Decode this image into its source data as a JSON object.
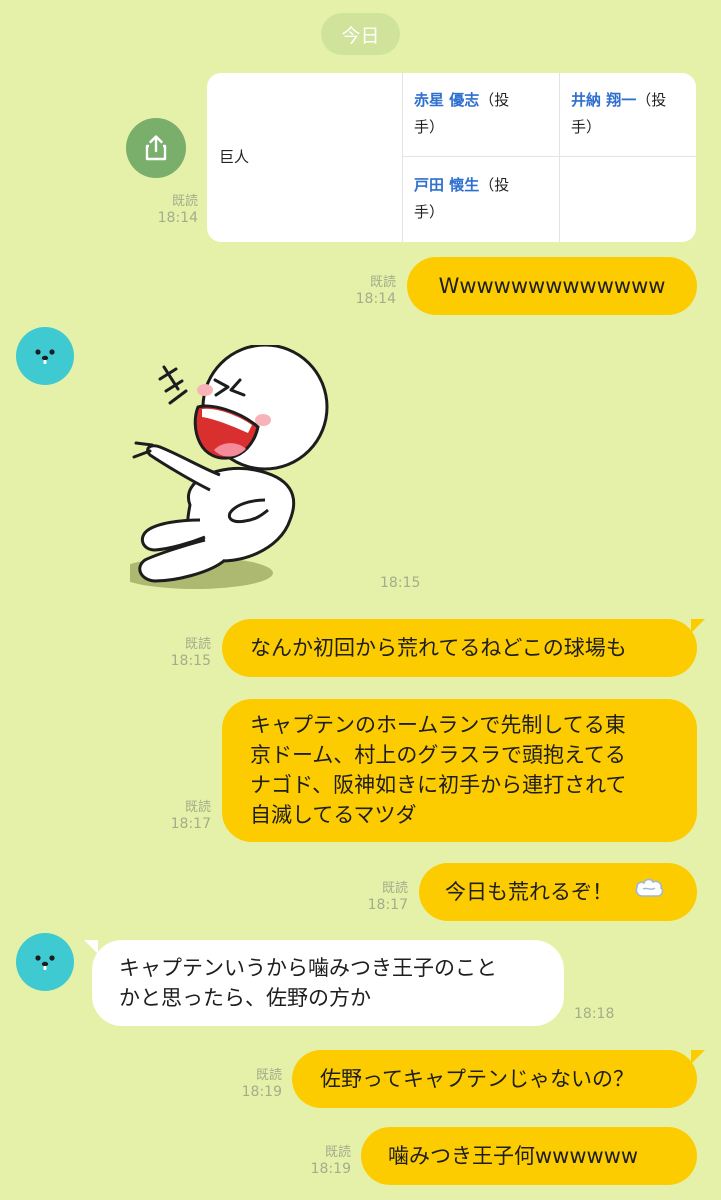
{
  "date_separator": "今日",
  "card": {
    "team": "巨人",
    "players": [
      {
        "name": "赤星 優志",
        "role_line1": "（投",
        "role_line2": "手）"
      },
      {
        "name": "井納 翔一",
        "role_line1": "（投",
        "role_line2": "手）"
      },
      {
        "name": "戸田 懐生",
        "role_line1": "（投",
        "role_line2": "手）"
      }
    ],
    "read": "既読",
    "time": "18:14"
  },
  "messages": [
    {
      "text": "Wwwwwwwwwwwww",
      "read": "既読",
      "time": "18:14"
    },
    {
      "sticker": "laughing-moon-sticker",
      "time": "18:15"
    },
    {
      "text": "なんか初回から荒れてるねどこの球場も",
      "read": "既読",
      "time": "18:15"
    },
    {
      "lines": [
        "キャプテンのホームランで先制してる東",
        "京ドーム、村上のグラスラで頭抱えてる",
        "ナゴド、阪神如きに初手から連打されて",
        "自滅してるマツダ"
      ],
      "read": "既読",
      "time": "18:17"
    },
    {
      "text": "今日も荒れるぞ！",
      "emoji": "dash-emoji",
      "read": "既読",
      "time": "18:17"
    },
    {
      "lines": [
        "キャプテンいうから噛みつき王子のこと",
        "かと思ったら、佐野の方か"
      ],
      "time": "18:18"
    },
    {
      "text": "佐野ってキャプテンじゃないの？",
      "read": "既読",
      "time": "18:19"
    },
    {
      "text": "噛みつき王子何wwwwww",
      "read": "既読",
      "time": "18:19"
    }
  ],
  "colors": {
    "background": "#e5f1a9",
    "outgoing_bubble": "#fccc00",
    "incoming_bubble": "#ffffff",
    "avatar": "#3fc9d1",
    "share_button": "#7aae6b",
    "link": "#2f6fd0"
  }
}
